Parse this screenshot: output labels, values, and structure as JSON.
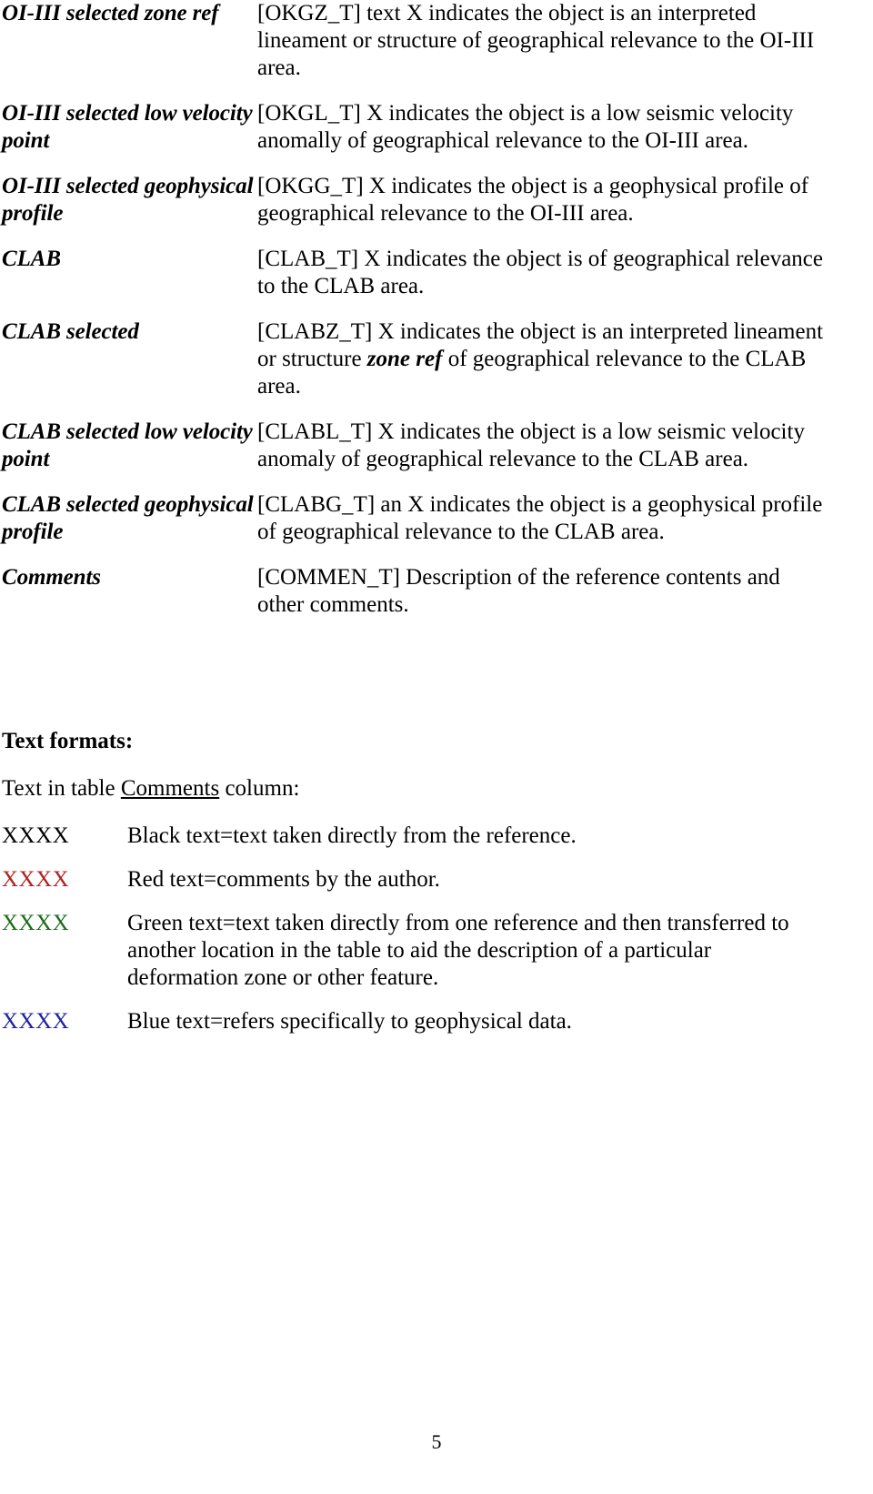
{
  "definitions": {
    "rows": [
      {
        "term": "OI-III selected zone ref",
        "desc_pre": "[OKGZ_T] text X indicates the object is an interpreted lineament or structure of geographical relevance to the OI-III area.",
        "desc_emph": "",
        "desc_post": ""
      },
      {
        "term": "OI-III selected low velocity point",
        "desc_pre": "[OKGL_T] X indicates the object is a low seismic velocity anomally of  geographical relevance to the OI-III area.",
        "desc_emph": "",
        "desc_post": ""
      },
      {
        "term": "OI-III selected geophysical profile",
        "desc_pre": "[OKGG_T] X indicates the object is a geophysical profile of geographical relevance to the OI-III area.",
        "desc_emph": "",
        "desc_post": ""
      },
      {
        "term": "CLAB",
        "desc_pre": "[CLAB_T] X indicates the object is of geographical relevance to the CLAB area.",
        "desc_emph": "",
        "desc_post": ""
      },
      {
        "term": "CLAB selected",
        "desc_pre": "[CLABZ_T] X indicates the object is an interpreted lineament or structure ",
        "desc_emph": "zone ref",
        "desc_post": " of geographical relevance to the CLAB area."
      },
      {
        "term": "CLAB selected low velocity point",
        "desc_pre": "[CLABL_T] X indicates the object is a low seismic velocity anomaly of   geographical relevance to the CLAB area.",
        "desc_emph": "",
        "desc_post": ""
      },
      {
        "term": "CLAB selected geophysical profile",
        "desc_pre": "[CLABG_T] an X indicates the object is a geophysical profile of geographical relevance to the CLAB area.",
        "desc_emph": "",
        "desc_post": ""
      },
      {
        "term": "Comments",
        "desc_pre": "[COMMEN_T] Description of the reference contents and other comments.",
        "desc_emph": "",
        "desc_post": ""
      }
    ]
  },
  "formats": {
    "heading": "Text formats:",
    "subheading_pre": "Text in table ",
    "subheading_underlined": "Comments",
    "subheading_post": " column:",
    "legend": [
      {
        "swatch": "XXXX",
        "color": "#000000",
        "text": "Black text=text taken directly from the reference."
      },
      {
        "swatch": "XXXX",
        "color": "#B02020",
        "text": "Red text=comments by the author."
      },
      {
        "swatch": "XXXX",
        "color": "#1A6B1A",
        "text": "Green text=text taken directly from one reference and then transferred to another location in the table to aid the description of a particular deformation zone or other feature."
      },
      {
        "swatch": "XXXX",
        "color": "#20209B",
        "text": "Blue text=refers specifically to geophysical data."
      }
    ]
  },
  "footer": {
    "page_number": "5"
  }
}
